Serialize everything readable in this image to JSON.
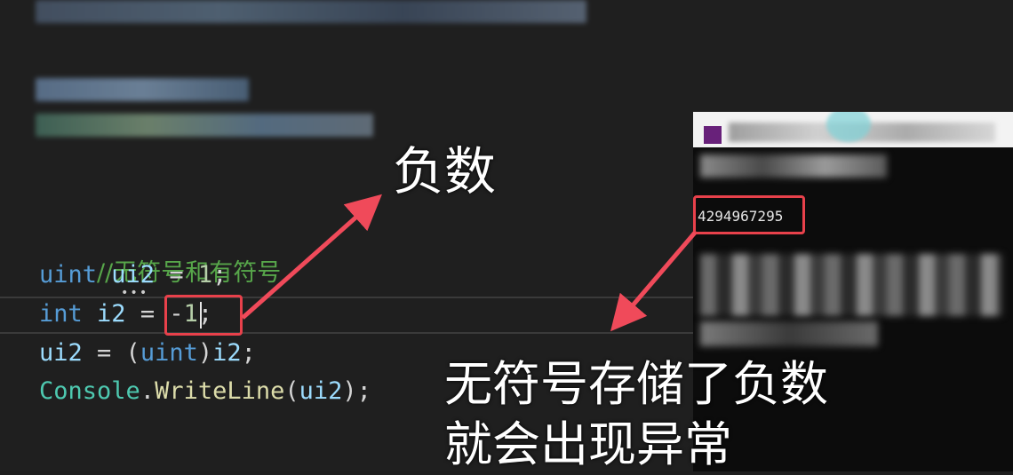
{
  "editor": {
    "comment": "//无符号和有符号",
    "line1": {
      "kw": "uint",
      "var": "ui2",
      "op": " = ",
      "val": "1",
      "end": ";"
    },
    "line2": {
      "kw": "int",
      "var": "i2",
      "op": " = ",
      "neg": "-",
      "val": "1",
      "end": ";"
    },
    "line3": {
      "var": "ui2",
      "op": " = (",
      "kw": "uint",
      "close": ")",
      "rhs": "i2",
      "end": ";"
    },
    "line4": {
      "type": "Console",
      "dot": ".",
      "fn": "WriteLine",
      "open": "(",
      "arg": "ui2",
      "close": ");"
    }
  },
  "console": {
    "output": "4294967295"
  },
  "annotations": {
    "negative": "负数",
    "explain_line1": "无符号存储了负数",
    "explain_line2": "就会出现异常"
  },
  "colors": {
    "highlight": "#e8414b",
    "arrow": "#f04a5a",
    "keyword": "#569cd6",
    "comment": "#57a64a"
  }
}
